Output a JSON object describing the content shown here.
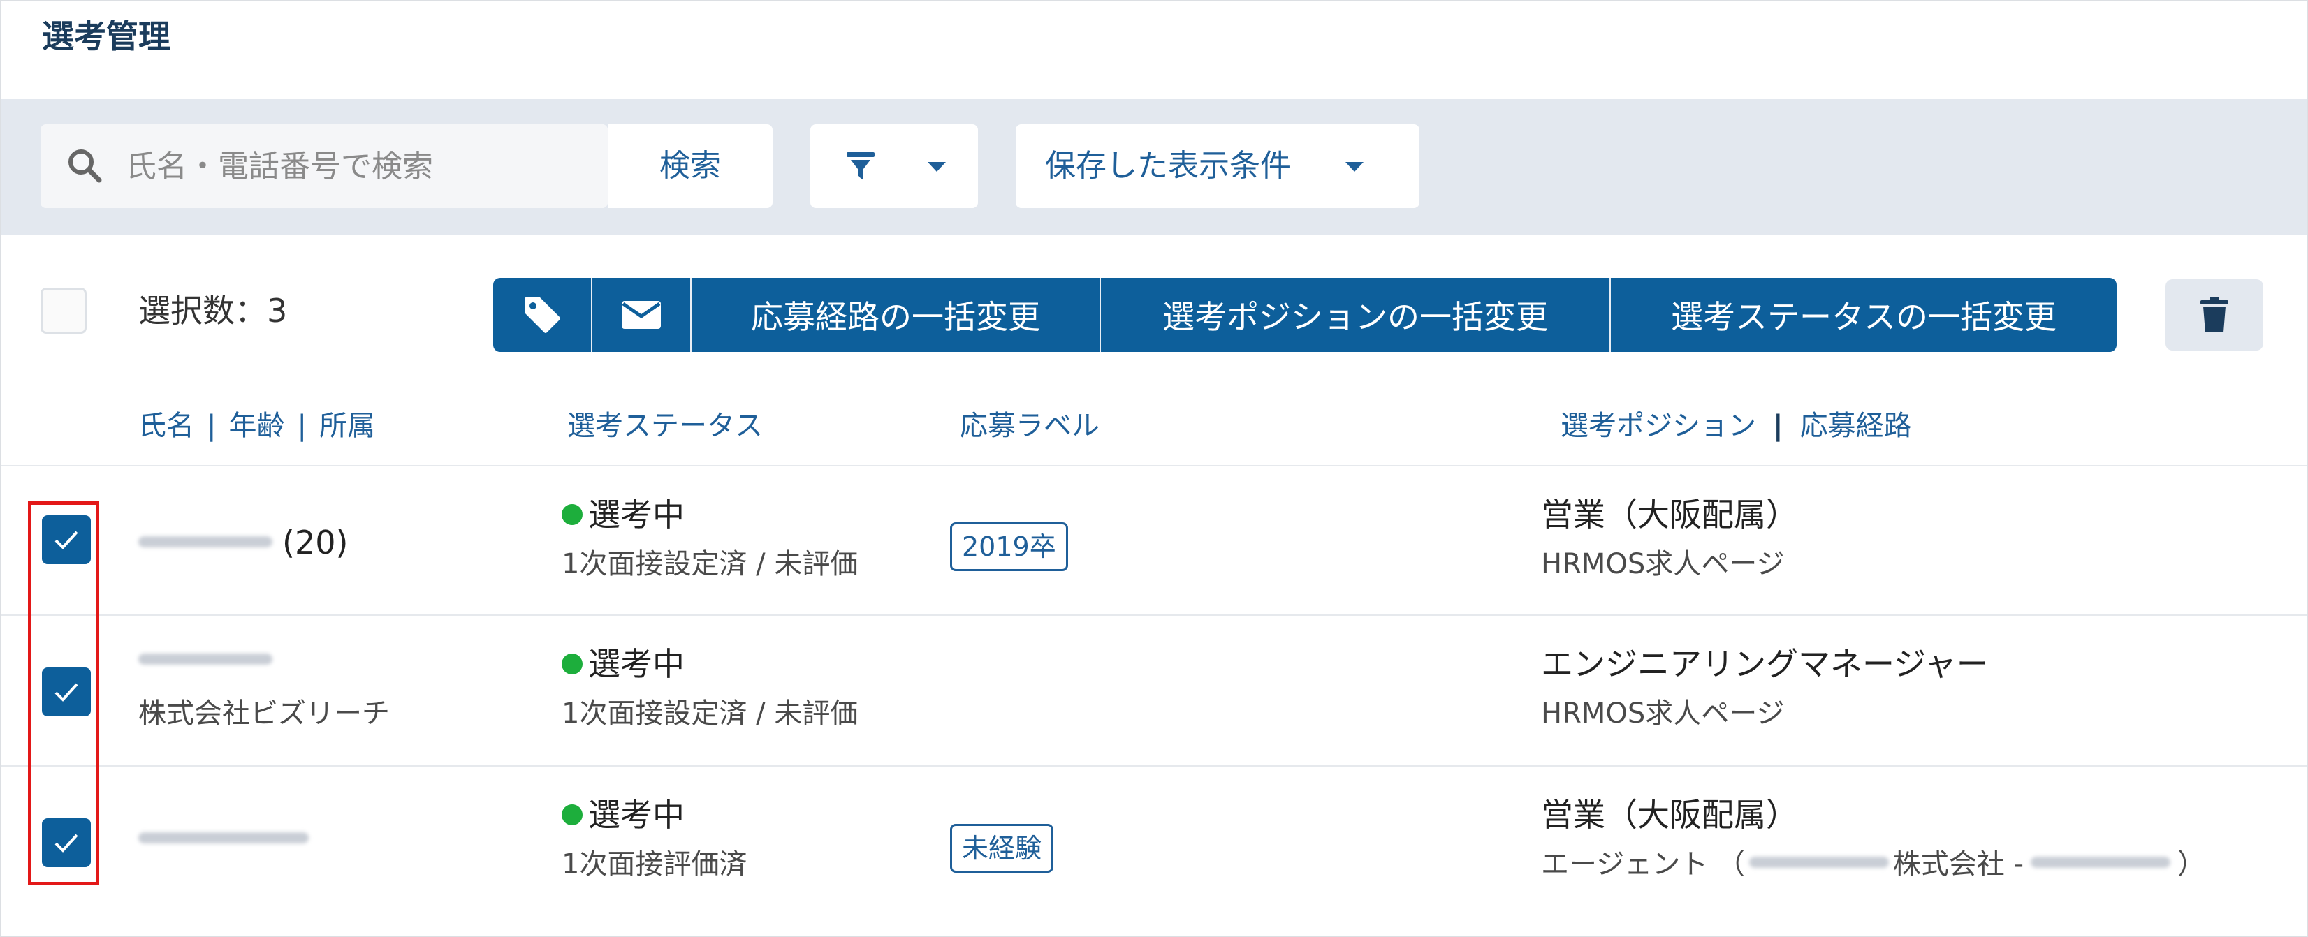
{
  "page": {
    "title": "選考管理"
  },
  "search": {
    "placeholder": "氏名・電話番号で検索",
    "value": "",
    "button_label": "検索"
  },
  "filter": {
    "icon": "filter-icon",
    "dropdown_icon": "chevron-down-icon"
  },
  "saved_conditions": {
    "label": "保存した表示条件",
    "dropdown_icon": "chevron-down-icon"
  },
  "bulk": {
    "selected_count": "選択数：3",
    "actions": [
      {
        "icon": "tag-icon"
      },
      {
        "icon": "mail-icon"
      },
      {
        "label": "応募経路の一括変更"
      },
      {
        "label": "選考ポジションの一括変更"
      },
      {
        "label": "選考ステータスの一括変更"
      }
    ],
    "delete_icon": "trash-icon"
  },
  "columns": {
    "name": "氏名",
    "age": "年齢",
    "affiliation": "所属",
    "status": "選考ステータス",
    "label": "応募ラベル",
    "position": "選考ポジション",
    "route": "応募経路",
    "separator": "|"
  },
  "rows": [
    {
      "checked": true,
      "age_text": "(20)",
      "affiliation": "",
      "status": "選考中",
      "status_color": "#1dae3c",
      "status_detail": "1次面接設定済 / 未評価",
      "tag": "2019卒",
      "position": "営業（大阪配属）",
      "route": "HRMOS求人ページ"
    },
    {
      "checked": true,
      "age_text": "",
      "affiliation": "株式会社ビズリーチ",
      "status": "選考中",
      "status_color": "#1dae3c",
      "status_detail": "1次面接設定済 / 未評価",
      "tag": "",
      "position": "エンジニアリングマネージャー",
      "route": "HRMOS求人ページ"
    },
    {
      "checked": true,
      "age_text": "",
      "affiliation": "",
      "status": "選考中",
      "status_color": "#1dae3c",
      "status_detail": "1次面接評価済",
      "tag": "未経験",
      "position": "営業（大阪配属）",
      "route_prefix": "エージェント （",
      "route_middle": "株式会社 -",
      "route_suffix": "）"
    }
  ],
  "colors": {
    "primary": "#0d5f9b",
    "link": "#1f5f99",
    "toolbar_bg": "#e3e8ef",
    "highlight": "#e31818"
  }
}
